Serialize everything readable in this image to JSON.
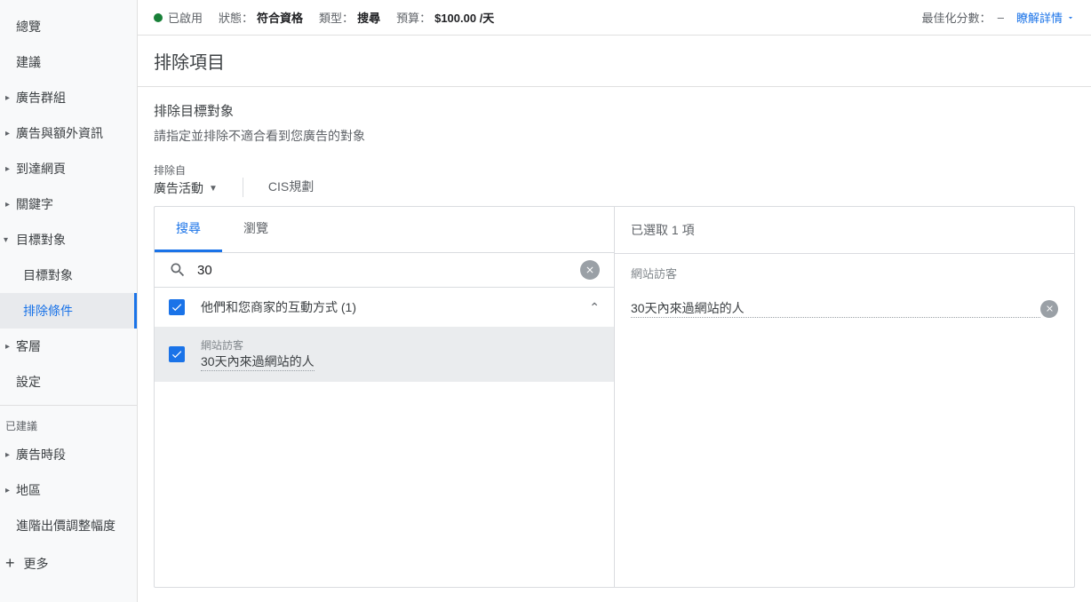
{
  "sidebar": {
    "items": [
      {
        "label": "總覽",
        "type": "plain"
      },
      {
        "label": "建議",
        "type": "plain"
      },
      {
        "label": "廣告群組",
        "type": "arrow"
      },
      {
        "label": "廣告與額外資訊",
        "type": "arrow"
      },
      {
        "label": "到達網頁",
        "type": "arrow"
      },
      {
        "label": "關鍵字",
        "type": "arrow"
      },
      {
        "label": "目標對象",
        "type": "expanded"
      },
      {
        "label": "目標對象",
        "type": "sub"
      },
      {
        "label": "排除條件",
        "type": "sub-active"
      },
      {
        "label": "客層",
        "type": "arrow"
      },
      {
        "label": "設定",
        "type": "plain"
      }
    ],
    "suggested_label": "已建議",
    "suggested": [
      {
        "label": "廣告時段",
        "type": "arrow"
      },
      {
        "label": "地區",
        "type": "arrow"
      },
      {
        "label": "進階出價調整幅度",
        "type": "plain"
      }
    ],
    "more": "更多"
  },
  "status_bar": {
    "enabled": "已啟用",
    "status_label": "狀態：",
    "status_value": "符合資格",
    "type_label": "類型：",
    "type_value": "搜尋",
    "budget_label": "預算：",
    "budget_value": "$100.00 /天",
    "score_label": "最佳化分數：",
    "score_value": "–",
    "learn_more": "瞭解詳情"
  },
  "page": {
    "title": "排除項目",
    "section_title": "排除目標對象",
    "section_desc": "請指定並排除不適合看到您廣告的對象",
    "exclude_from_label": "排除自",
    "exclude_from_value": "廣告活動",
    "campaign_name": "CIS規劃"
  },
  "tabs": {
    "search": "搜尋",
    "browse": "瀏覽"
  },
  "search": {
    "value": "30"
  },
  "results": {
    "group_label": "他們和您商家的互動方式 (1)",
    "item_category": "網站訪客",
    "item_name": "30天內來過網站的人"
  },
  "selected_pane": {
    "header": "已選取 1 項",
    "group": "網站訪客",
    "item": "30天內來過網站的人"
  }
}
